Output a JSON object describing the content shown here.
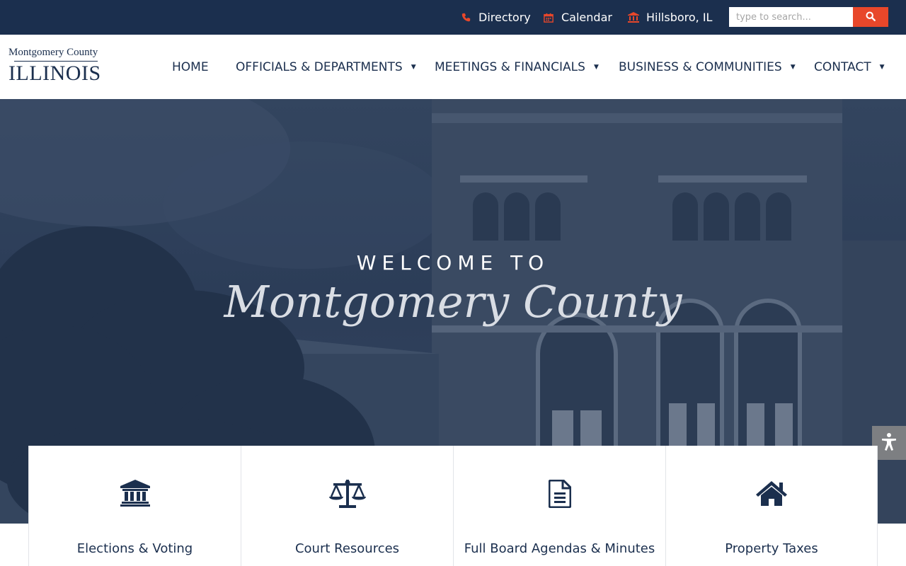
{
  "utility_bar": {
    "directory_label": "Directory",
    "calendar_label": "Calendar",
    "location_label": "Hillsboro, IL",
    "search_placeholder": "type to search...",
    "accent_color": "#e8472a",
    "background_color": "#1b2f4e"
  },
  "logo": {
    "top_line": "Montgomery County",
    "main_line": "ILLINOIS"
  },
  "nav": {
    "items": [
      {
        "label": "HOME",
        "has_dropdown": false
      },
      {
        "label": "OFFICIALS & DEPARTMENTS",
        "has_dropdown": true
      },
      {
        "label": "MEETINGS & FINANCIALS",
        "has_dropdown": true
      },
      {
        "label": "BUSINESS & COMMUNITIES",
        "has_dropdown": true
      },
      {
        "label": "CONTACT",
        "has_dropdown": true
      }
    ]
  },
  "hero": {
    "welcome_text": "WELCOME TO",
    "title_script": "Montgomery County"
  },
  "cards": [
    {
      "label": "Elections & Voting",
      "icon": "institution-icon"
    },
    {
      "label": "Court Resources",
      "icon": "scales-icon"
    },
    {
      "label": "Full Board Agendas & Minutes",
      "icon": "document-icon"
    },
    {
      "label": "Property Taxes",
      "icon": "home-icon"
    }
  ],
  "icons": {
    "directory": "phone-icon",
    "calendar": "calendar-icon",
    "location": "bank-icon",
    "search": "search-icon",
    "accessibility": "accessibility-icon"
  }
}
